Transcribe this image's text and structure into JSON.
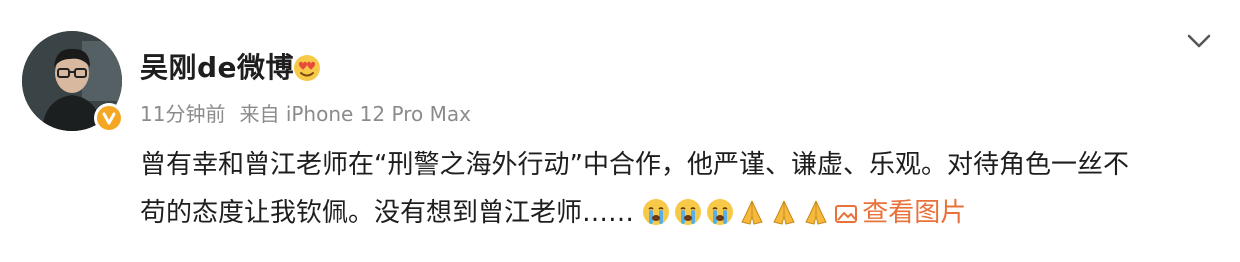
{
  "post": {
    "author": "吴刚de微博",
    "time": "11分钟前",
    "source_prefix": "来自",
    "source_device": "iPhone 12 Pro Max",
    "text_line1": "曾有幸和曾江老师在“刑警之海外行动”中合作，他严谨、谦虚、乐观。对待角色一丝不",
    "text_line2": "苟的态度让我钦佩。没有想到曾江老师……",
    "view_images_label": "查看图片",
    "emojis": [
      "crying-face-icon",
      "crying-face-icon",
      "crying-face-icon",
      "folded-hands-icon",
      "folded-hands-icon",
      "folded-hands-icon"
    ]
  },
  "colors": {
    "link": "#e9723a",
    "meta": "#8b8b8b",
    "text": "#1e1e1e",
    "verified_badge": "#f5a623"
  }
}
